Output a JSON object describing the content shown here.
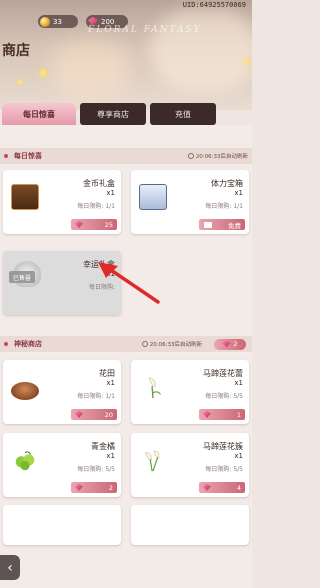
{
  "header": {
    "uid": "UID:64925570069",
    "gold": "33",
    "gems": "200",
    "title": "商店",
    "banner_text": "FLORAL FANTASY"
  },
  "tabs": [
    {
      "label": "每日惊喜",
      "active": true
    },
    {
      "label": "尊享商店",
      "active": false
    },
    {
      "label": "充值",
      "active": false
    }
  ],
  "daily": {
    "title": "每日惊喜",
    "timer": "20:06:33后自动刷新",
    "items": [
      {
        "name": "金币礼盒",
        "qty": "x1",
        "limit": "每日限购: 1/1",
        "price": "25",
        "icon": "gold-chest-icon"
      },
      {
        "name": "体力宝箱",
        "qty": "x1",
        "limit": "每日限购: 1/1",
        "price": "免费",
        "icon": "blue-chest-icon"
      },
      {
        "name": "幸运礼盒",
        "qty": "x1",
        "limit": "每日限购:",
        "badge": "已售罄",
        "icon": "heart-box-icon"
      }
    ]
  },
  "mystery": {
    "title": "神秘商店",
    "timer": "20:06:33后自动刷新",
    "refresh_cost": "2",
    "items": [
      {
        "name": "花田",
        "qty": "x1",
        "limit": "每日限购: 1/1",
        "price": "20",
        "icon": "flower-field-icon"
      },
      {
        "name": "马蹄莲花蕾",
        "qty": "x1",
        "limit": "每日限购: 5/5",
        "price": "1",
        "icon": "calla-bud-icon"
      },
      {
        "name": "青金橘",
        "qty": "x1",
        "limit": "每日限购: 5/5",
        "price": "2",
        "icon": "kumquat-icon"
      },
      {
        "name": "马蹄莲花簇",
        "qty": "x1",
        "limit": "每日限购: 5/5",
        "price": "4",
        "icon": "calla-cluster-icon"
      }
    ]
  },
  "colors": {
    "accent": "#cc6675",
    "tab_dark": "#3b2a29"
  }
}
